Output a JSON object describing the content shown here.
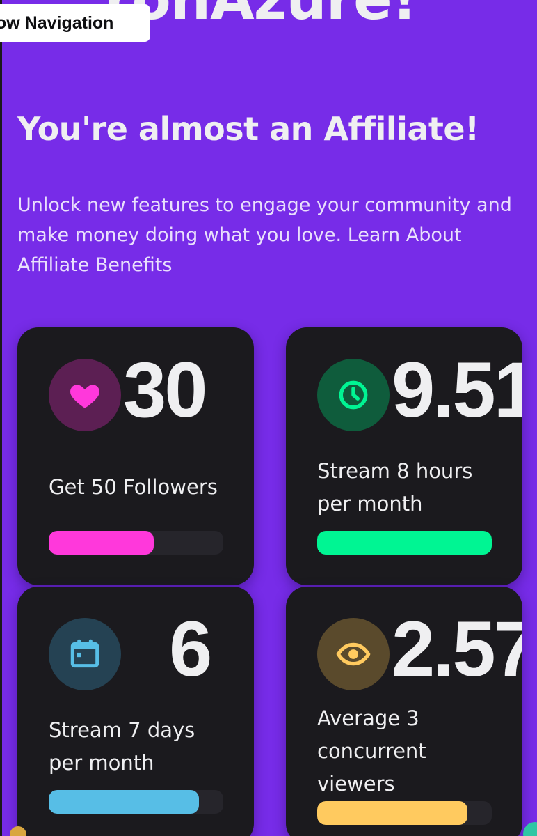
{
  "header": {
    "partial_title": "ronAzure!",
    "nav_toggle_label": "ow Navigation"
  },
  "hero": {
    "headline": "You're almost an Affiliate!",
    "description": "Unlock new features to engage your community and make money doing what you love.",
    "link_text": "Learn About Affiliate Benefits"
  },
  "cards": [
    {
      "value": "30",
      "goal": "Get 50 Followers",
      "icon": "heart-icon",
      "progress": 0.6,
      "accent_color": "#ff38db",
      "icon_bg": "#5c1f53"
    },
    {
      "value": "9.51",
      "goal": "Stream 8 hours per month",
      "icon": "clock-icon",
      "progress": 1.0,
      "accent_color": "#00f593",
      "icon_bg": "#0f5c3c"
    },
    {
      "value": "6",
      "goal": "Stream 7 days per month",
      "icon": "calendar-icon",
      "progress": 0.86,
      "accent_color": "#57bee6",
      "icon_bg": "#254253"
    },
    {
      "value": "2.57",
      "goal": "Average 3 concurrent viewers",
      "icon": "eye-icon",
      "progress": 0.86,
      "accent_color": "#ffca5f",
      "icon_bg": "#5a4a2c"
    }
  ],
  "colors": {
    "page_background": "#772ce8",
    "card_background": "#1b1a1e",
    "track": "#26252b"
  }
}
